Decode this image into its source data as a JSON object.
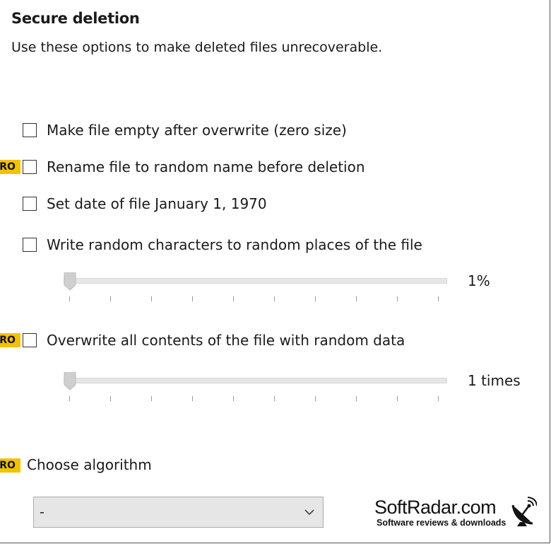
{
  "section": {
    "title": "Secure deletion",
    "description": "Use these options to make deleted files unrecoverable."
  },
  "pro_badge": "PRO",
  "options": {
    "empty_file": "Make file empty after overwrite (zero size)",
    "rename_file": "Rename file to random name before deletion",
    "set_date": "Set date of file January 1, 1970",
    "random_chars": "Write random characters to random places of the file",
    "overwrite_all": "Overwrite all contents of the file with random data"
  },
  "sliders": {
    "random_chars_value": "1%",
    "overwrite_times_value": "1 times"
  },
  "algorithm": {
    "label": "Choose algorithm",
    "selected": "-"
  },
  "watermark": {
    "name": "SoftRadar.com",
    "tagline": "Software reviews & downloads",
    "icon": "satellite-dish-icon"
  },
  "colors": {
    "pro_badge": "#f2c200",
    "slider_track": "#e6e6e6",
    "select_bg": "#e6e6e6"
  }
}
